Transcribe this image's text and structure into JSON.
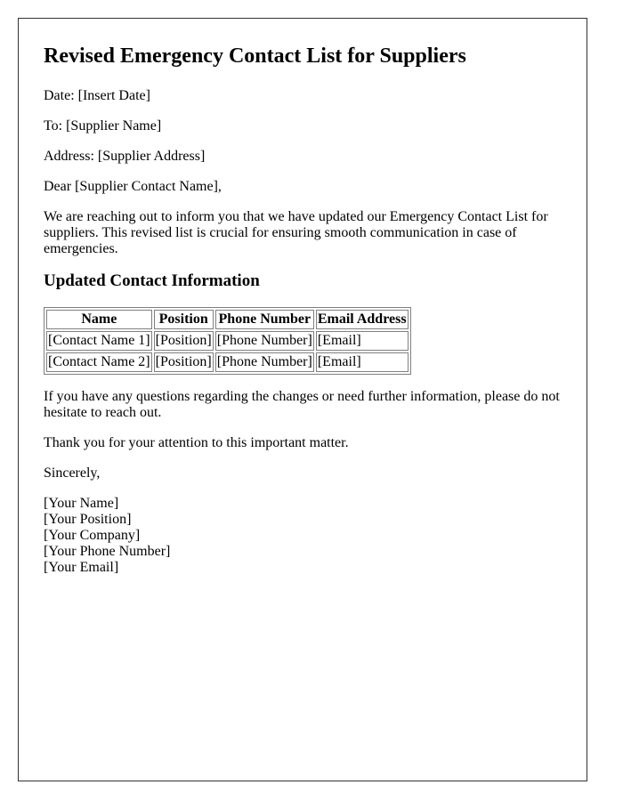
{
  "document": {
    "title": "Revised Emergency Contact List for Suppliers",
    "date_line": "Date: [Insert Date]",
    "to_line": "To: [Supplier Name]",
    "address_line": "Address: [Supplier Address]",
    "salutation": "Dear [Supplier Contact Name],",
    "intro_paragraph": "We are reaching out to inform you that we have updated our Emergency Contact List for suppliers. This revised list is crucial for ensuring smooth communication in case of emergencies.",
    "section_heading": "Updated Contact Information",
    "table": {
      "headers": [
        "Name",
        "Position",
        "Phone Number",
        "Email Address"
      ],
      "rows": [
        [
          "[Contact Name 1]",
          "[Position]",
          "[Phone Number]",
          "[Email]"
        ],
        [
          "[Contact Name 2]",
          "[Position]",
          "[Phone Number]",
          "[Email]"
        ]
      ]
    },
    "questions_paragraph": "If you have any questions regarding the changes or need further information, please do not hesitate to reach out.",
    "thanks_paragraph": "Thank you for your attention to this important matter.",
    "closing": "Sincerely,",
    "signature": [
      "[Your Name]",
      "[Your Position]",
      "[Your Company]",
      "[Your Phone Number]",
      "[Your Email]"
    ]
  }
}
